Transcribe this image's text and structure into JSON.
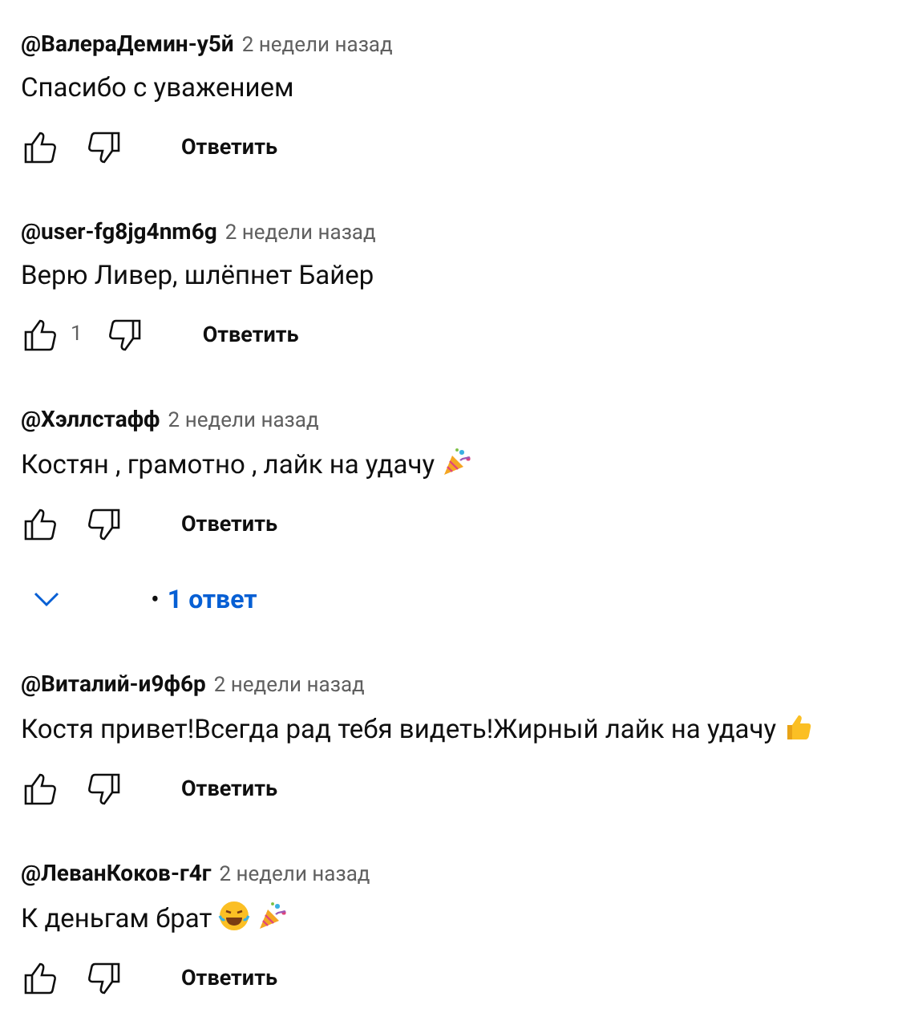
{
  "comments": [
    {
      "author": "@ВалераДемин-у5й",
      "time": "2 недели назад",
      "text": "Спасибо с уважением",
      "reply_label": "Ответить"
    },
    {
      "author": "@user-fg8jg4nm6g",
      "time": "2 недели назад",
      "text": "Верю Ливер, шлёпнет Байер",
      "likes": "1",
      "reply_label": "Ответить"
    },
    {
      "author": "@Хэллстафф",
      "time": "2 недели назад",
      "text": "Костян , грамотно , лайк на удачу",
      "emojis": [
        {
          "kind": "party"
        }
      ],
      "reply_label": "Ответить",
      "replies": {
        "bullet": "•",
        "label": "1 ответ",
        "expanded": false
      }
    },
    {
      "author": "@Виталий-и9ф6р",
      "time": "2 недели назад",
      "text": "Костя привет!Всегда рад тебя видеть!Жирный лайк на удачу",
      "emojis": [
        {
          "kind": "thumbs-up"
        }
      ],
      "reply_label": "Ответить"
    },
    {
      "author": "@ЛеванКоков-г4г",
      "time": "2 недели назад",
      "text": "К деньгам брат",
      "emojis": [
        {
          "kind": "laughing"
        },
        {
          "kind": "party"
        }
      ],
      "reply_label": "Ответить"
    }
  ]
}
